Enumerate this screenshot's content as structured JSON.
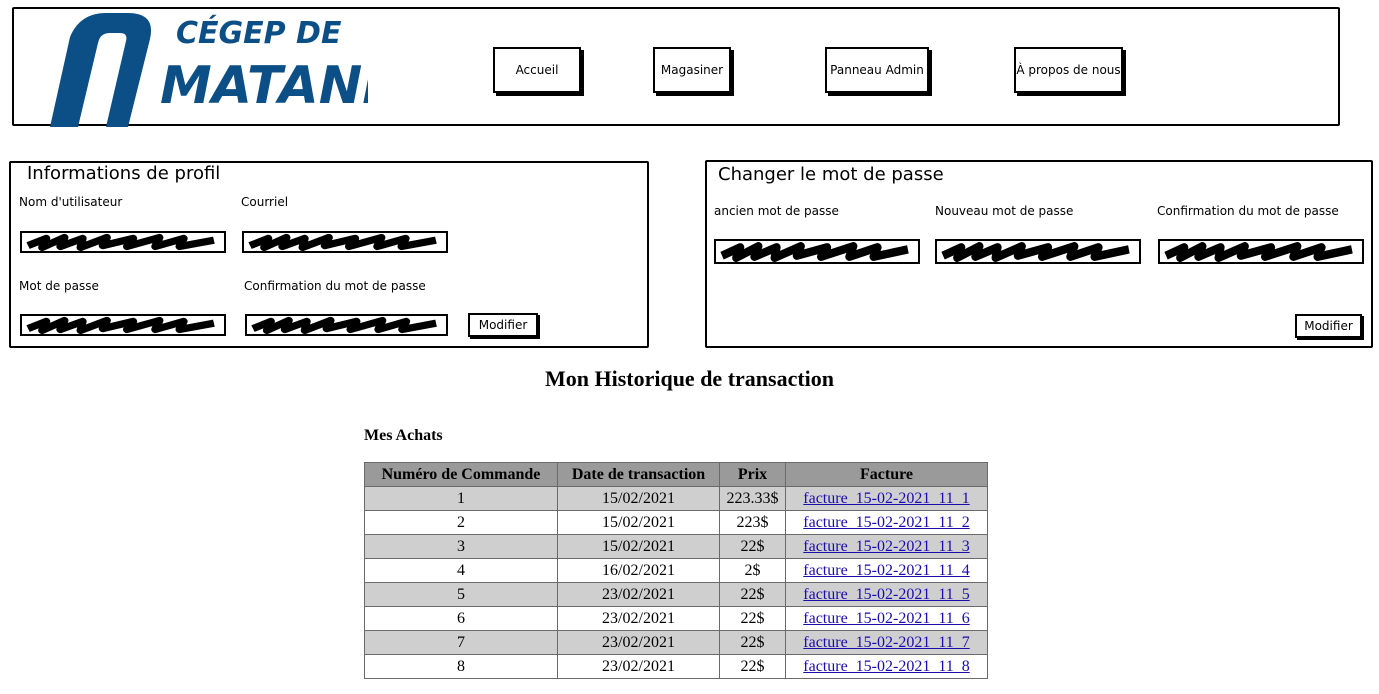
{
  "header": {
    "logo": {
      "line1": "CÉGEP DE",
      "line2": "MATANE",
      "color": "#0b4f86"
    },
    "nav": [
      {
        "label": "Accueil"
      },
      {
        "label": "Magasiner"
      },
      {
        "label": "Panneau Admin"
      },
      {
        "label": "À propos de nous"
      }
    ]
  },
  "profile": {
    "title": "Informations de profil",
    "username_label": "Nom d'utilisateur",
    "email_label": "Courriel",
    "password_label": "Mot de passe",
    "confirm_label": "Confirmation du mot de passe",
    "modify_label": "Modifier"
  },
  "password_change": {
    "title": "Changer le mot de passe",
    "old_label": "ancien mot de passe",
    "new_label": "Nouveau mot de passe",
    "confirm_label": "Confirmation du mot de passe",
    "modify_label": "Modifier"
  },
  "history": {
    "title": "Mon Historique de transaction",
    "purchases_title": "Mes Achats",
    "columns": [
      "Numéro de Commande",
      "Date de transaction",
      "Prix",
      "Facture"
    ],
    "rows": [
      [
        "1",
        "15/02/2021",
        "223.33$",
        "facture_15-02-2021_11_1"
      ],
      [
        "2",
        "15/02/2021",
        "223$",
        "facture_15-02-2021_11_2"
      ],
      [
        "3",
        "15/02/2021",
        "22$",
        "facture_15-02-2021_11_3"
      ],
      [
        "4",
        "16/02/2021",
        "2$",
        "facture_15-02-2021_11_4"
      ],
      [
        "5",
        "23/02/2021",
        "22$",
        "facture_15-02-2021_11_5"
      ],
      [
        "6",
        "23/02/2021",
        "22$",
        "facture_15-02-2021_11_6"
      ],
      [
        "7",
        "23/02/2021",
        "22$",
        "facture_15-02-2021_11_7"
      ],
      [
        "8",
        "23/02/2021",
        "22$",
        "facture_15-02-2021_11_8"
      ]
    ]
  },
  "colors": {
    "header_row": "#9a9a9a",
    "alt_row": "#cfcfcf",
    "link": "#1a0dab"
  }
}
